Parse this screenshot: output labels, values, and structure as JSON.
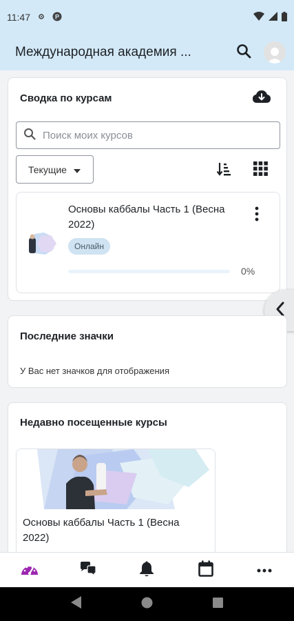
{
  "status_bar": {
    "time": "11:47"
  },
  "app_bar": {
    "title": "Международная академия ..."
  },
  "course_overview": {
    "title": "Сводка по курсам",
    "search_placeholder": "Поиск моих курсов",
    "filter_label": "Текущие",
    "courses": [
      {
        "name": "Основы каббалы Часть 1 (Весна 2022)",
        "badge": "Онлайн",
        "progress_text": "0%",
        "progress": 0
      }
    ]
  },
  "recent_badges": {
    "title": "Последние значки",
    "empty_text": "У Вас нет значков для отображения"
  },
  "recent_courses": {
    "title": "Недавно посещенные курсы",
    "items": [
      {
        "name": "Основы каббалы Часть 1 (Весна 2022)"
      }
    ]
  },
  "bottom_nav": [
    "dashboard-icon",
    "messages-icon",
    "notifications-icon",
    "calendar-icon",
    "more-icon"
  ],
  "colors": {
    "accent": "#9c27b0",
    "header_bg": "#d3e9f8",
    "badge_bg": "#cfe3f2"
  }
}
